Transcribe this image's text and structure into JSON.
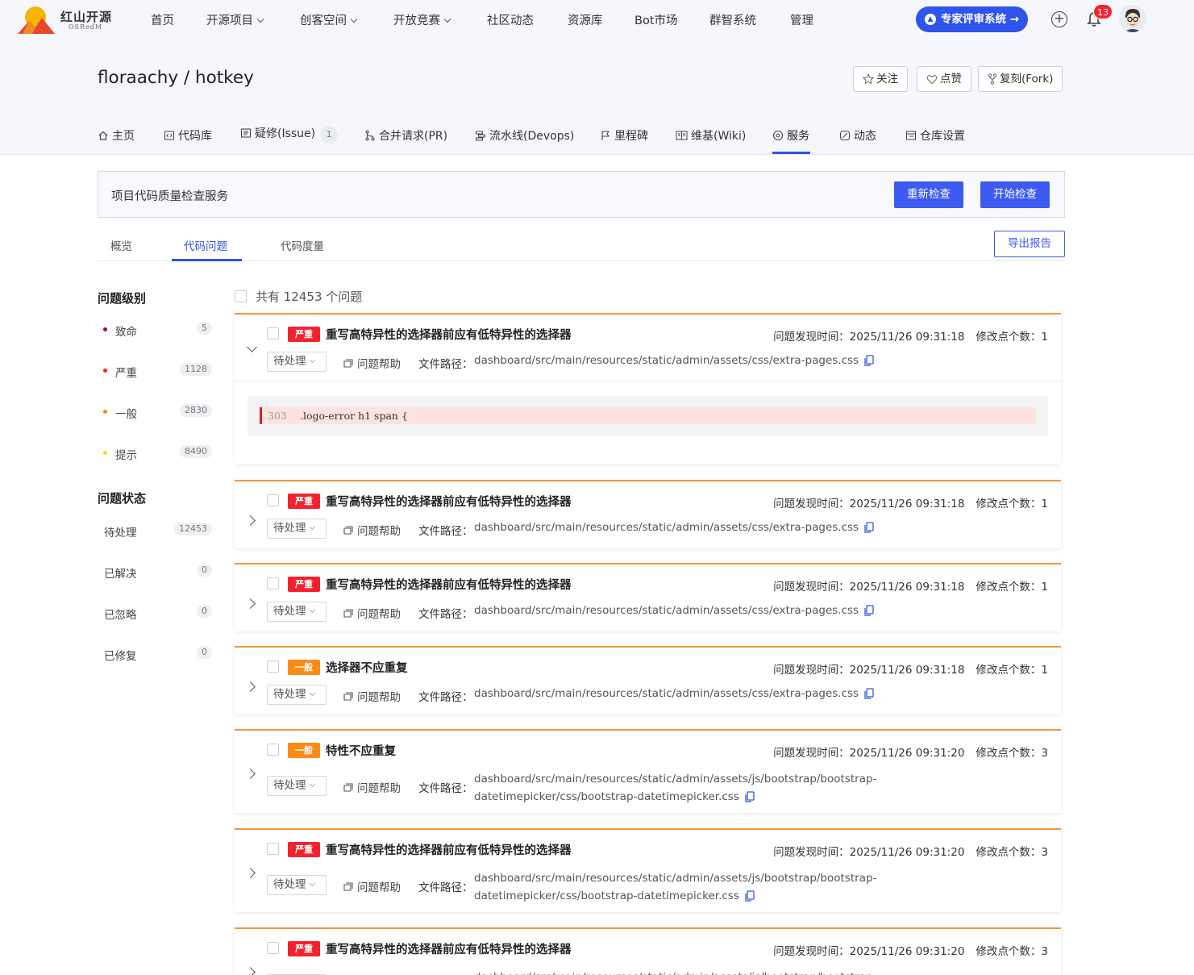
{
  "brand": {
    "name_cn": "红山开源",
    "name_en": "OSRedM"
  },
  "nav": {
    "items": [
      "首页",
      "开源项目",
      "创客空间",
      "开放竞赛",
      "社区动态",
      "资源库",
      "Bot市场",
      "群智系统",
      "管理"
    ],
    "expert_button": "专家评审系统",
    "notification_count": "13"
  },
  "repo": {
    "title": "floraachy / hotkey",
    "watch_label": "关注",
    "star_label": "点赞",
    "fork_label": "复刻(Fork)"
  },
  "tabs": [
    {
      "label": "主页",
      "icon": "home-icon"
    },
    {
      "label": "代码库",
      "icon": "code-icon"
    },
    {
      "label": "疑修(Issue)",
      "icon": "issue-icon",
      "count": "1"
    },
    {
      "label": "合并请求(PR)",
      "icon": "merge-icon"
    },
    {
      "label": "流水线(Devops)",
      "icon": "pipeline-icon"
    },
    {
      "label": "里程碑",
      "icon": "flag-icon"
    },
    {
      "label": "维基(Wiki)",
      "icon": "book-icon"
    },
    {
      "label": "服务",
      "icon": "service-icon",
      "active": true
    },
    {
      "label": "动态",
      "icon": "activity-icon"
    },
    {
      "label": "仓库设置",
      "icon": "settings-icon"
    }
  ],
  "service": {
    "title": "项目代码质量检查服务",
    "recheck_label": "重新检查",
    "start_label": "开始检查"
  },
  "subtabs": {
    "items": [
      "概览",
      "代码问题",
      "代码度量"
    ],
    "active": "代码问题",
    "export_label": "导出报告"
  },
  "filters": {
    "level_heading": "问题级别",
    "levels": [
      {
        "label": "致命",
        "count": "5",
        "color": "#a8071a"
      },
      {
        "label": "严重",
        "count": "1128",
        "color": "#f5222d"
      },
      {
        "label": "一般",
        "count": "2830",
        "color": "#fa8c16"
      },
      {
        "label": "提示",
        "count": "8490",
        "color": "#fadb14"
      }
    ],
    "status_heading": "问题状态",
    "statuses": [
      {
        "label": "待处理",
        "count": "12453"
      },
      {
        "label": "已解决",
        "count": "0"
      },
      {
        "label": "已忽略",
        "count": "0"
      },
      {
        "label": "已修复",
        "count": "0"
      }
    ]
  },
  "issues_summary": {
    "total_text": "共有 12453 个问题"
  },
  "issue_common": {
    "time_label": "问题发现时间：",
    "changes_label": "修改点个数：",
    "status_value": "待处理",
    "help_label": "问题帮助",
    "path_label": "文件路径："
  },
  "severity_colors": {
    "严重": "#f5222d",
    "一般": "#fa8c16"
  },
  "issues": [
    {
      "severity": "严重",
      "title": "重写高特异性的选择器前应有低特异性的选择器",
      "time": "2025/11/26 09:31:18",
      "changes": "1",
      "path": "dashboard/src/main/resources/static/admin/assets/css/extra-pages.css",
      "expanded": true,
      "code": {
        "line": "303",
        "text": ".logo-error h1 span {"
      }
    },
    {
      "severity": "严重",
      "title": "重写高特异性的选择器前应有低特异性的选择器",
      "time": "2025/11/26 09:31:18",
      "changes": "1",
      "path": "dashboard/src/main/resources/static/admin/assets/css/extra-pages.css"
    },
    {
      "severity": "严重",
      "title": "重写高特异性的选择器前应有低特异性的选择器",
      "time": "2025/11/26 09:31:18",
      "changes": "1",
      "path": "dashboard/src/main/resources/static/admin/assets/css/extra-pages.css"
    },
    {
      "severity": "一般",
      "title": "选择器不应重复",
      "time": "2025/11/26 09:31:18",
      "changes": "1",
      "path": "dashboard/src/main/resources/static/admin/assets/css/extra-pages.css"
    },
    {
      "severity": "一般",
      "title": "特性不应重复",
      "time": "2025/11/26 09:31:20",
      "changes": "3",
      "path_line1": "dashboard/src/main/resources/static/admin/assets/js/bootstrap/bootstrap-",
      "path_line2": "datetimepicker/css/bootstrap-datetimepicker.css"
    },
    {
      "severity": "严重",
      "title": "重写高特异性的选择器前应有低特异性的选择器",
      "time": "2025/11/26 09:31:20",
      "changes": "3",
      "path_line1": "dashboard/src/main/resources/static/admin/assets/js/bootstrap/bootstrap-",
      "path_line2": "datetimepicker/css/bootstrap-datetimepicker.css"
    },
    {
      "severity": "严重",
      "title": "重写高特异性的选择器前应有低特异性的选择器",
      "time": "2025/11/26 09:31:20",
      "changes": "3",
      "path_line1": "dashboard/src/main/resources/static/admin/assets/js/bootstrap/bootstrap-"
    }
  ]
}
